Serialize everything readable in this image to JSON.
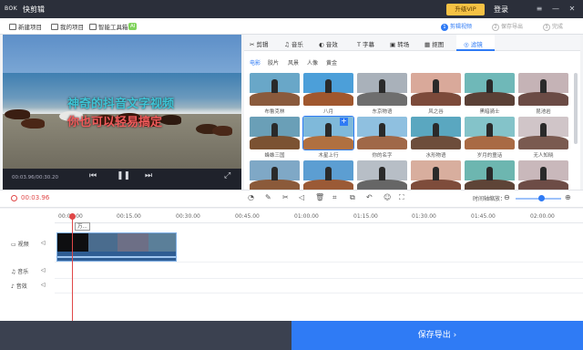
{
  "app": {
    "logo_text": "BOK",
    "name": "快剪辑",
    "vip_label": "升级VIP",
    "login_label": "登录"
  },
  "window_controls": {
    "menu": "≡",
    "minimize": "—",
    "close": "✕"
  },
  "toolbar": {
    "new_project": "新建项目",
    "my_projects": "我的项目",
    "smart_tools": "智能工具箱",
    "ai_badge": "AI"
  },
  "steps": [
    {
      "num": "1",
      "label": "剪辑视频"
    },
    {
      "num": "2",
      "label": "保存导出"
    },
    {
      "num": "3",
      "label": "完成"
    }
  ],
  "preview": {
    "subtitle_line1": "神奇的抖音文字视频",
    "subtitle_line2": "你也可以轻易搞定",
    "timecode": "00:03.96/00:30.20"
  },
  "tabs": [
    "剪辑",
    "音乐",
    "音效",
    "字幕",
    "转场",
    "抠图",
    "滤镜"
  ],
  "filter_categories": [
    "电影",
    "胶片",
    "风景",
    "人像",
    "黄金"
  ],
  "filters": [
    {
      "label": "布鲁克林",
      "sky": "#69a7c8",
      "tone": "#8a5a3c"
    },
    {
      "label": "八月",
      "sky": "#4c9fd9",
      "tone": "#a0572e"
    },
    {
      "label": "东京物语",
      "sky": "#a9b1ba",
      "tone": "#6e6e6e"
    },
    {
      "label": "风之谷",
      "sky": "#d9a99a",
      "tone": "#7c4a3a"
    },
    {
      "label": "黑暗骑士",
      "sky": "#6fb8b8",
      "tone": "#5a4036"
    },
    {
      "label": "昆池岩",
      "sky": "#c5b3b6",
      "tone": "#6b4b45"
    },
    {
      "label": "蜂蛛三国",
      "sky": "#6a9fb7",
      "tone": "#7b5232"
    },
    {
      "label": "木星上行",
      "sky": "#7fb9da",
      "tone": "#b07040"
    },
    {
      "label": "你的名字",
      "sky": "#8fc0e0",
      "tone": "#a06848"
    },
    {
      "label": "水形物语",
      "sky": "#5aa7c0",
      "tone": "#6d4d3b"
    },
    {
      "label": "岁月的童话",
      "sky": "#84c3c9",
      "tone": "#a96a44"
    },
    {
      "label": "无人知晓",
      "sky": "#d0c5c8",
      "tone": "#7a5a50"
    },
    {
      "label": "",
      "sky": "#7fa8c6",
      "tone": "#8b5a3a"
    },
    {
      "label": "",
      "sky": "#5c9ed2",
      "tone": "#9b5a36"
    },
    {
      "label": "",
      "sky": "#b7bec6",
      "tone": "#666666"
    },
    {
      "label": "",
      "sky": "#d8ae9e",
      "tone": "#7e4c3b"
    },
    {
      "label": "",
      "sky": "#6db6b0",
      "tone": "#5e4437"
    },
    {
      "label": "",
      "sky": "#c9b8bb",
      "tone": "#6d4c46"
    }
  ],
  "edit_bar": {
    "current_time": "00:03.96",
    "zoom_label": "时间轴缩放："
  },
  "ruler_ticks": [
    "00:00.00",
    "00:15.00",
    "00:30.00",
    "00:45.00",
    "01:00.00",
    "01:15.00",
    "01:30.00",
    "01:45.00",
    "02:00.00"
  ],
  "tracks": {
    "video": "视频",
    "music": "音乐",
    "sfx": "音效"
  },
  "clip_tooltip": "万...",
  "export_label": "保存导出",
  "colors": {
    "accent": "#2f7bf5",
    "title_bar": "#2b2f3a",
    "playhead": "#e04848",
    "vip": "#f6c244"
  }
}
